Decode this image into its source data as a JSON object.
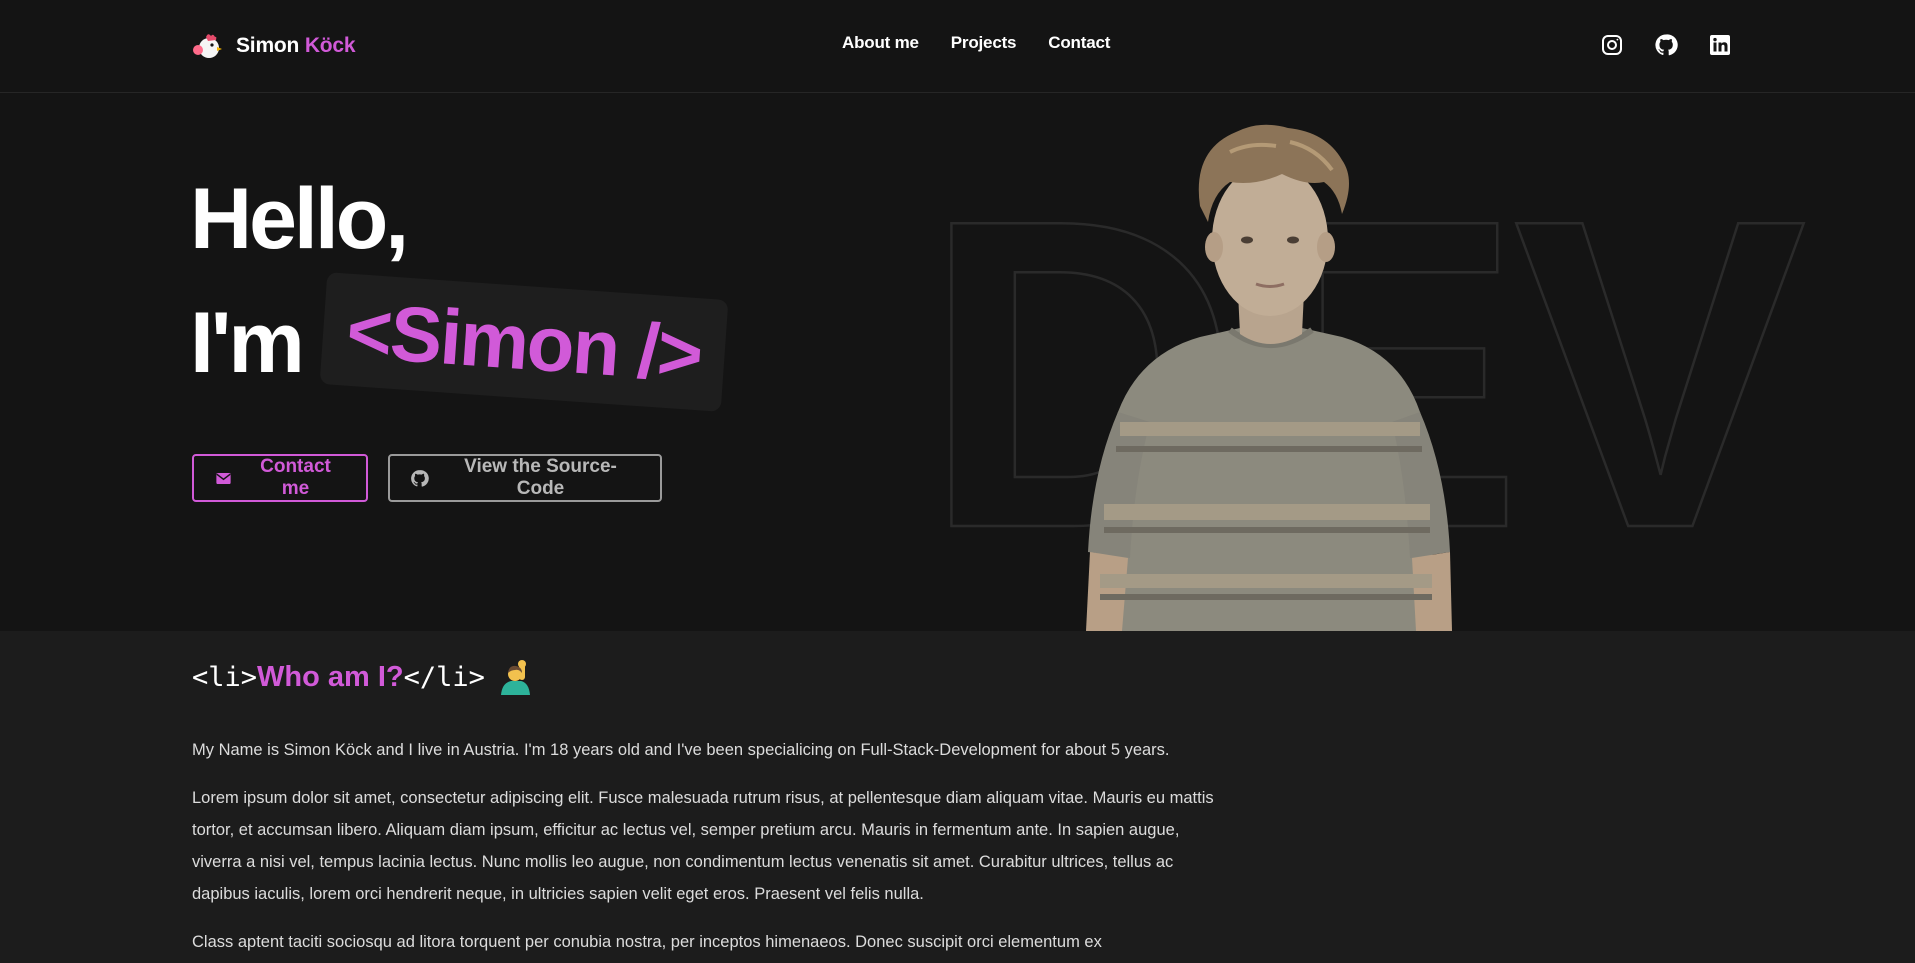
{
  "nav": {
    "brand_first": "Simon",
    "brand_last": "Köck",
    "links": [
      {
        "label": "About me"
      },
      {
        "label": "Projects"
      },
      {
        "label": "Contact"
      }
    ],
    "socials": [
      "instagram-icon",
      "github-icon",
      "linkedin-icon"
    ]
  },
  "hero": {
    "greeting": "Hello,",
    "intro": "I'm",
    "name_tag": "<Simon />",
    "background_word": "DEV",
    "contact_button": "Contact me",
    "source_button": "View the Source-Code"
  },
  "about": {
    "tag_open": "<li>",
    "title": "Who am I?",
    "tag_close": "</li>",
    "paragraphs": [
      "My Name is Simon Köck and I live in Austria. I'm 18 years old and I've been specialicing on Full-Stack-Development for about 5 years.",
      "Lorem ipsum dolor sit amet, consectetur adipiscing elit. Fusce malesuada rutrum risus, at pellentesque diam aliquam vitae. Mauris eu mattis tortor, et accumsan libero. Aliquam diam ipsum, efficitur ac lectus vel, semper pretium arcu. Mauris in fermentum ante. In sapien augue, viverra a nisi vel, tempus lacinia lectus. Nunc mollis leo augue, non condimentum lectus venenatis sit amet. Curabitur ultrices, tellus ac dapibus iaculis, lorem orci hendrerit neque, in ultricies sapien velit eget eros. Praesent vel felis nulla.",
      "Class aptent taciti sociosqu ad litora torquent per conubia nostra, per inceptos himenaeos. Donec suscipit orci elementum ex"
    ]
  },
  "colors": {
    "accent": "#d15ad8",
    "background": "#141414",
    "section_background": "#1c1c1c",
    "text": "#ffffff"
  }
}
